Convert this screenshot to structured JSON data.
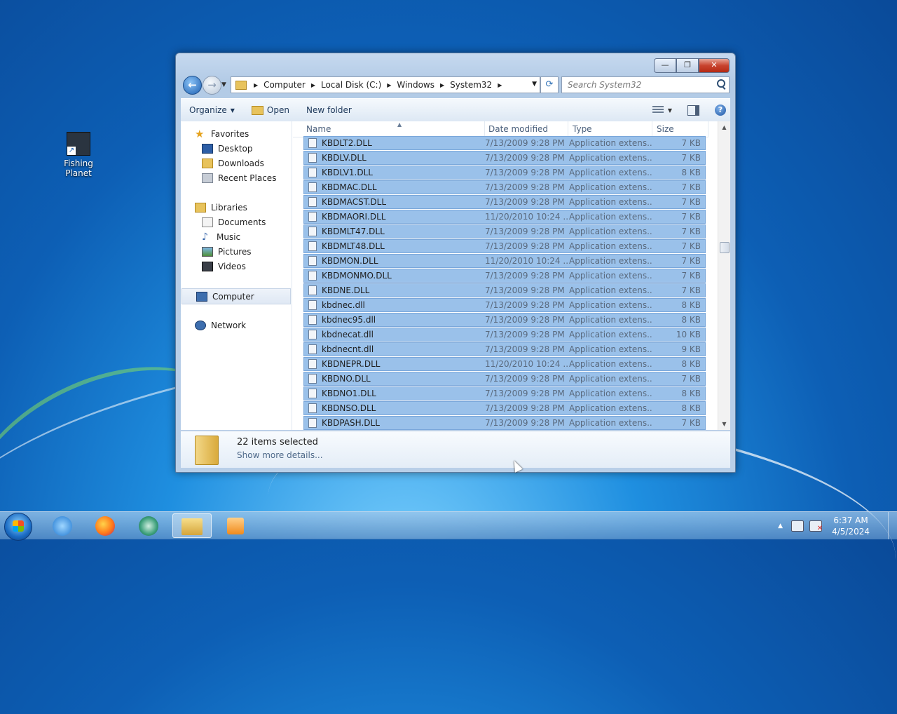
{
  "desktop": {
    "icons": [
      {
        "label": "Fishing Planet"
      }
    ]
  },
  "window": {
    "controls": {
      "minimize": "—",
      "maximize": "❐",
      "close": "✕"
    },
    "address": {
      "crumbs": [
        "Computer",
        "Local Disk (C:)",
        "Windows",
        "System32"
      ]
    },
    "search": {
      "placeholder": "Search System32",
      "value": ""
    },
    "toolbar": {
      "organize": "Organize",
      "open": "Open",
      "new_folder": "New folder"
    },
    "nav": {
      "favorites": "Favorites",
      "desktop": "Desktop",
      "downloads": "Downloads",
      "recent": "Recent Places",
      "libraries": "Libraries",
      "documents": "Documents",
      "music": "Music",
      "pictures": "Pictures",
      "videos": "Videos",
      "computer": "Computer",
      "network": "Network"
    },
    "columns": {
      "name": "Name",
      "date": "Date modified",
      "type": "Type",
      "size": "Size"
    },
    "rows": [
      {
        "name": "KBDLT2.DLL",
        "date": "7/13/2009 9:28 PM",
        "type": "Application extens...",
        "size": "7 KB"
      },
      {
        "name": "KBDLV.DLL",
        "date": "7/13/2009 9:28 PM",
        "type": "Application extens...",
        "size": "7 KB"
      },
      {
        "name": "KBDLV1.DLL",
        "date": "7/13/2009 9:28 PM",
        "type": "Application extens...",
        "size": "8 KB"
      },
      {
        "name": "KBDMAC.DLL",
        "date": "7/13/2009 9:28 PM",
        "type": "Application extens...",
        "size": "7 KB"
      },
      {
        "name": "KBDMACST.DLL",
        "date": "7/13/2009 9:28 PM",
        "type": "Application extens...",
        "size": "7 KB"
      },
      {
        "name": "KBDMAORI.DLL",
        "date": "11/20/2010 10:24 ...",
        "type": "Application extens...",
        "size": "7 KB"
      },
      {
        "name": "KBDMLT47.DLL",
        "date": "7/13/2009 9:28 PM",
        "type": "Application extens...",
        "size": "7 KB"
      },
      {
        "name": "KBDMLT48.DLL",
        "date": "7/13/2009 9:28 PM",
        "type": "Application extens...",
        "size": "7 KB"
      },
      {
        "name": "KBDMON.DLL",
        "date": "11/20/2010 10:24 ...",
        "type": "Application extens...",
        "size": "7 KB"
      },
      {
        "name": "KBDMONMO.DLL",
        "date": "7/13/2009 9:28 PM",
        "type": "Application extens...",
        "size": "7 KB"
      },
      {
        "name": "KBDNE.DLL",
        "date": "7/13/2009 9:28 PM",
        "type": "Application extens...",
        "size": "7 KB"
      },
      {
        "name": "kbdnec.dll",
        "date": "7/13/2009 9:28 PM",
        "type": "Application extens...",
        "size": "8 KB"
      },
      {
        "name": "kbdnec95.dll",
        "date": "7/13/2009 9:28 PM",
        "type": "Application extens...",
        "size": "8 KB"
      },
      {
        "name": "kbdnecat.dll",
        "date": "7/13/2009 9:28 PM",
        "type": "Application extens...",
        "size": "10 KB"
      },
      {
        "name": "kbdnecnt.dll",
        "date": "7/13/2009 9:28 PM",
        "type": "Application extens...",
        "size": "9 KB"
      },
      {
        "name": "KBDNEPR.DLL",
        "date": "11/20/2010 10:24 ...",
        "type": "Application extens...",
        "size": "8 KB"
      },
      {
        "name": "KBDNO.DLL",
        "date": "7/13/2009 9:28 PM",
        "type": "Application extens...",
        "size": "7 KB"
      },
      {
        "name": "KBDNO1.DLL",
        "date": "7/13/2009 9:28 PM",
        "type": "Application extens...",
        "size": "8 KB"
      },
      {
        "name": "KBDNSO.DLL",
        "date": "7/13/2009 9:28 PM",
        "type": "Application extens...",
        "size": "8 KB"
      },
      {
        "name": "KBDPASH.DLL",
        "date": "7/13/2009 9:28 PM",
        "type": "Application extens...",
        "size": "7 KB"
      }
    ],
    "details": {
      "selection": "22 items selected",
      "more": "Show more details..."
    }
  },
  "taskbar": {
    "apps": [
      "internet-explorer",
      "firefox",
      "green-app",
      "windows-explorer",
      "media-player"
    ],
    "clock": {
      "time": "6:37 AM",
      "date": "4/5/2024"
    }
  },
  "colors": {
    "selection": "#9ac1ea",
    "selection_border": "#7aa7da",
    "close_button": "#c8432e"
  }
}
